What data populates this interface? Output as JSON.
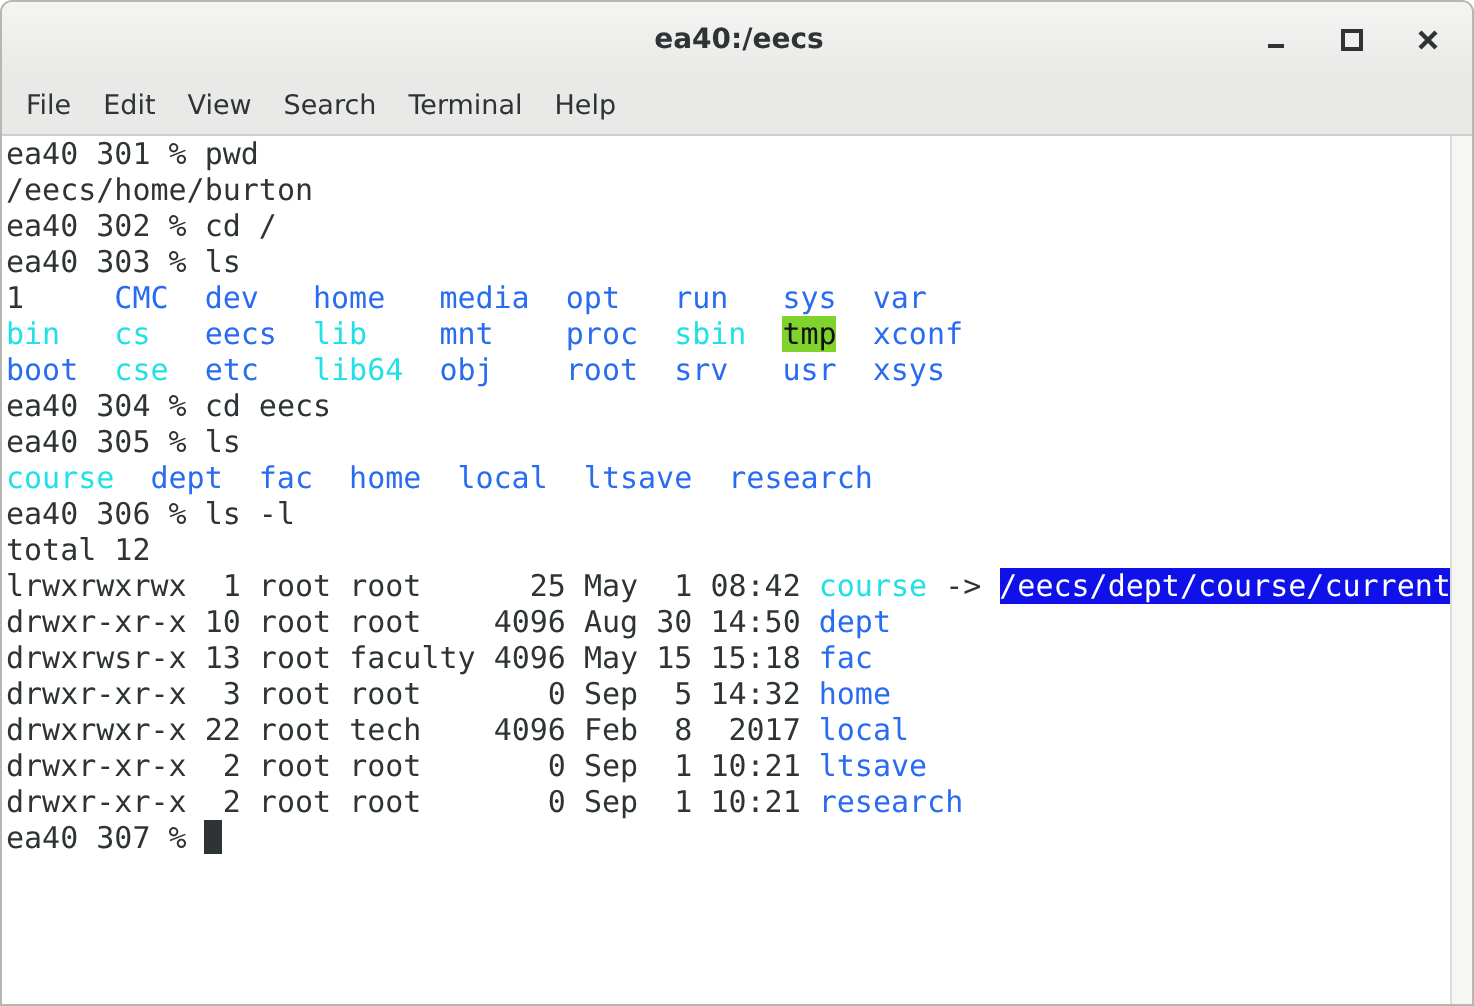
{
  "window": {
    "title": "ea40:/eecs"
  },
  "menu": [
    "File",
    "Edit",
    "View",
    "Search",
    "Terminal",
    "Help"
  ],
  "terminal": {
    "lines": [
      {
        "kind": "text",
        "text": "ea40 301 % pwd"
      },
      {
        "kind": "text",
        "text": "/eecs/home/burton"
      },
      {
        "kind": "text",
        "text": "ea40 302 % cd /"
      },
      {
        "kind": "text",
        "text": "ea40 303 % ls"
      },
      {
        "kind": "grid",
        "rows": [
          [
            {
              "name": "1",
              "kind": "file"
            },
            {
              "name": "CMC",
              "kind": "dir"
            },
            {
              "name": "dev",
              "kind": "dir"
            },
            {
              "name": "home",
              "kind": "dir"
            },
            {
              "name": "media",
              "kind": "dir"
            },
            {
              "name": "opt",
              "kind": "dir"
            },
            {
              "name": "run",
              "kind": "dir"
            },
            {
              "name": "sys",
              "kind": "dir"
            },
            {
              "name": "var",
              "kind": "dir"
            }
          ],
          [
            {
              "name": "bin",
              "kind": "link"
            },
            {
              "name": "cs",
              "kind": "link"
            },
            {
              "name": "eecs",
              "kind": "dir"
            },
            {
              "name": "lib",
              "kind": "link"
            },
            {
              "name": "mnt",
              "kind": "dir"
            },
            {
              "name": "proc",
              "kind": "dir"
            },
            {
              "name": "sbin",
              "kind": "link"
            },
            {
              "name": "tmp",
              "kind": "sticky"
            },
            {
              "name": "xconf",
              "kind": "dir"
            }
          ],
          [
            {
              "name": "boot",
              "kind": "dir"
            },
            {
              "name": "cse",
              "kind": "link"
            },
            {
              "name": "etc",
              "kind": "dir"
            },
            {
              "name": "lib64",
              "kind": "link"
            },
            {
              "name": "obj",
              "kind": "dir"
            },
            {
              "name": "root",
              "kind": "dir"
            },
            {
              "name": "srv",
              "kind": "dir"
            },
            {
              "name": "usr",
              "kind": "dir"
            },
            {
              "name": "xsys",
              "kind": "dir"
            }
          ]
        ]
      },
      {
        "kind": "text",
        "text": "ea40 304 % cd eecs"
      },
      {
        "kind": "text",
        "text": "ea40 305 % ls"
      },
      {
        "kind": "grid",
        "rows": [
          [
            {
              "name": "course",
              "kind": "link"
            },
            {
              "name": "dept",
              "kind": "dir"
            },
            {
              "name": "fac",
              "kind": "dir"
            },
            {
              "name": "home",
              "kind": "dir"
            },
            {
              "name": "local",
              "kind": "dir"
            },
            {
              "name": "ltsave",
              "kind": "dir"
            },
            {
              "name": "research",
              "kind": "dir"
            }
          ]
        ]
      },
      {
        "kind": "text",
        "text": "ea40 306 % ls -l"
      },
      {
        "kind": "text",
        "text": "total 12"
      },
      {
        "kind": "listing",
        "details": "lrwxrwxrwx  1 root root      25 May  1 08:42",
        "entry": {
          "name": "course",
          "kind": "link"
        },
        "arrow": "->",
        "target": "/eecs/dept/course/current",
        "selected": true
      },
      {
        "kind": "listing",
        "details": "drwxr-xr-x 10 root root    4096 Aug 30 14:50",
        "entry": {
          "name": "dept",
          "kind": "dir"
        }
      },
      {
        "kind": "listing",
        "details": "drwxrwsr-x 13 root faculty 4096 May 15 15:18",
        "entry": {
          "name": "fac",
          "kind": "dir"
        }
      },
      {
        "kind": "listing",
        "details": "drwxr-xr-x  3 root root       0 Sep  5 14:32",
        "entry": {
          "name": "home",
          "kind": "dir"
        }
      },
      {
        "kind": "listing",
        "details": "drwxrwxr-x 22 root tech    4096 Feb  8  2017",
        "entry": {
          "name": "local",
          "kind": "dir"
        }
      },
      {
        "kind": "listing",
        "details": "drwxr-xr-x  2 root root       0 Sep  1 10:21",
        "entry": {
          "name": "ltsave",
          "kind": "dir"
        }
      },
      {
        "kind": "listing",
        "details": "drwxr-xr-x  2 root root       0 Sep  1 10:21",
        "entry": {
          "name": "research",
          "kind": "dir"
        }
      },
      {
        "kind": "prompt",
        "text": "ea40 307 %",
        "cursor": true
      }
    ]
  }
}
